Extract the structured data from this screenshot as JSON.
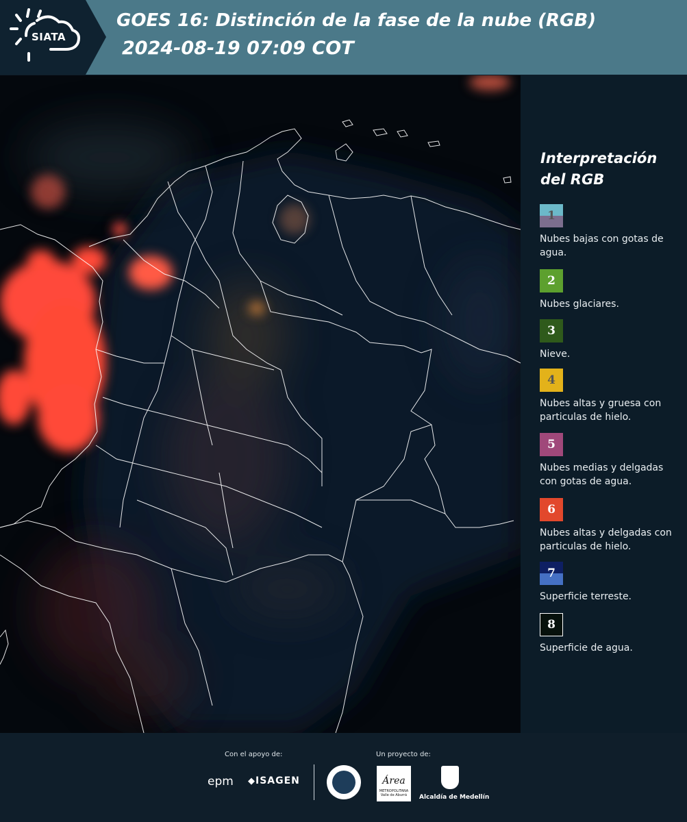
{
  "header": {
    "logo_text": "SIATA",
    "title_line1": "GOES 16: Distinción de la fase de la nube (RGB)",
    "title_line2": "2024-08-19 07:09 COT"
  },
  "legend": {
    "title": "Interpretación del RGB",
    "items": [
      {
        "number": "1",
        "label": "Nubes bajas con gotas de agua.",
        "color_top": "#6cb9c9",
        "color_bottom": "#7c6e8e",
        "number_color": "#555555"
      },
      {
        "number": "2",
        "label": "Nubes glaciares.",
        "color": "#5da02e",
        "number_color": "#ffffff"
      },
      {
        "number": "3",
        "label": "Nieve.",
        "color": "#2f5a1b",
        "number_color": "#ffffff"
      },
      {
        "number": "4",
        "label": "Nubes altas y gruesa con particulas de hielo.",
        "color": "#e3b21a",
        "number_color": "#555555"
      },
      {
        "number": "5",
        "label": "Nubes medias y delgadas con gotas de agua.",
        "color": "#a0487a",
        "number_color": "#ffffff"
      },
      {
        "number": "6",
        "label": "Nubes altas y delgadas con particulas de hielo.",
        "color": "#e2482c",
        "number_color": "#ffffff"
      },
      {
        "number": "7",
        "label": "Superficie terreste.",
        "color_top": "#0e1f63",
        "color_bottom": "#4570c4",
        "number_color": "#ffffff"
      },
      {
        "number": "8",
        "label": "Superficie de agua.",
        "color": "#07110c",
        "number_color": "#ffffff",
        "border": "#ffffff"
      }
    ]
  },
  "footer": {
    "support_label": "Con el apoyo de:",
    "project_label": "Un proyecto de:",
    "sponsor1": "epm",
    "sponsor2": "ISAGEN",
    "partner_amva": "Área",
    "partner_amva_sub": "METROPOLITANA Valle de Aburrá",
    "partner_medellin": "Alcaldía de Medellín"
  }
}
